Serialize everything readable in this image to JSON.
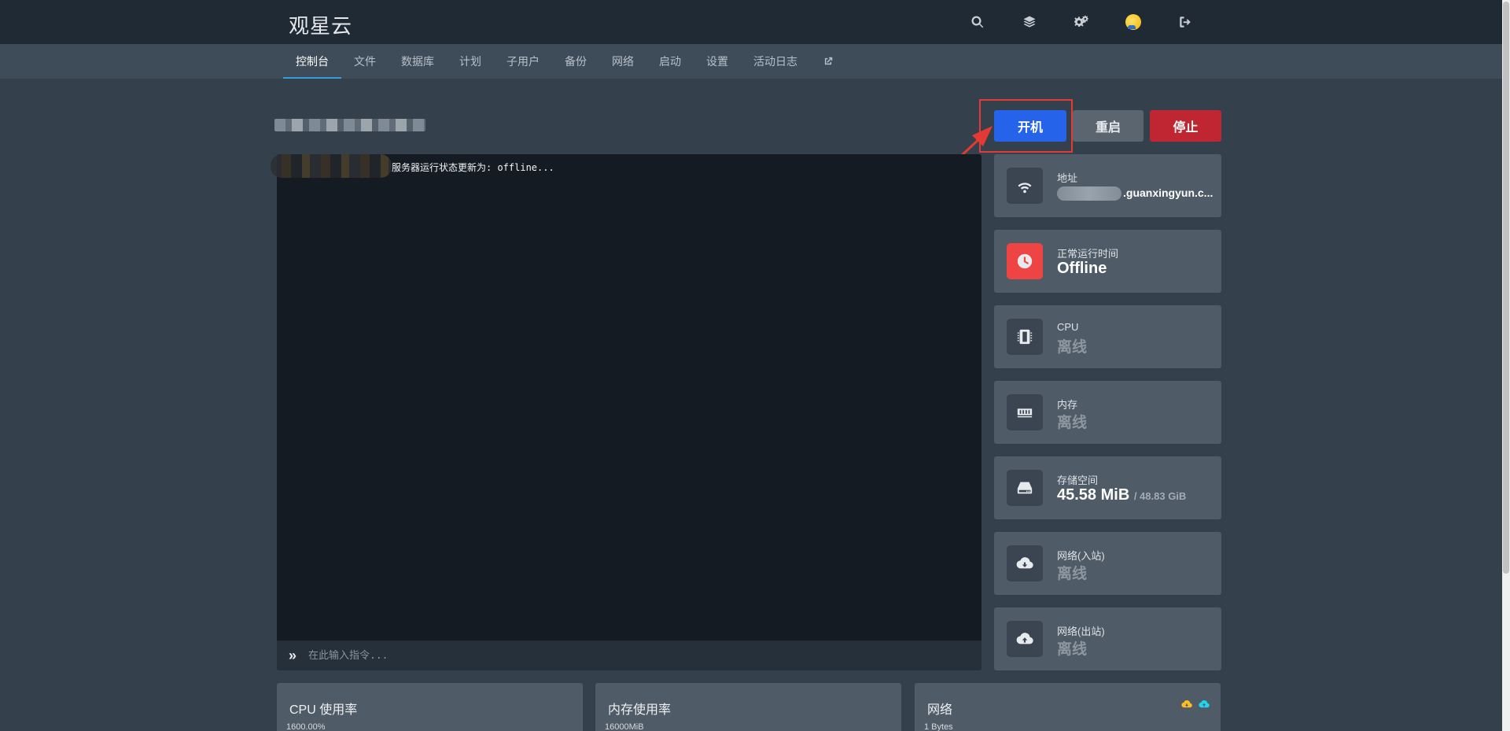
{
  "brand": "观星云",
  "header": {
    "icons": [
      "search-icon",
      "layers-icon",
      "cogs-icon",
      "avatar",
      "logout-icon"
    ]
  },
  "nav": {
    "tabs": [
      {
        "label": "控制台",
        "active": true
      },
      {
        "label": "文件"
      },
      {
        "label": "数据库"
      },
      {
        "label": "计划"
      },
      {
        "label": "子用户"
      },
      {
        "label": "备份"
      },
      {
        "label": "网络"
      },
      {
        "label": "启动"
      },
      {
        "label": "设置"
      },
      {
        "label": "活动日志"
      }
    ]
  },
  "power": {
    "start": "开机",
    "restart": "重启",
    "stop": "停止"
  },
  "console": {
    "line": "服务器运行状态更新为: offline...",
    "placeholder": "在此输入指令..."
  },
  "stats": {
    "address": {
      "label": "地址",
      "value": ".guanxingyun.c..."
    },
    "uptime": {
      "label": "正常运行时间",
      "value": "Offline"
    },
    "cpu": {
      "label": "CPU",
      "value": "离线"
    },
    "memory": {
      "label": "内存",
      "value": "离线"
    },
    "disk": {
      "label": "存储空间",
      "value": "45.58 MiB",
      "limit": "/ 48.83 GiB"
    },
    "net_in": {
      "label": "网络(入站)",
      "value": "离线"
    },
    "net_out": {
      "label": "网络(出站)",
      "value": "离线"
    }
  },
  "graphs": {
    "cpu": {
      "title": "CPU 使用率",
      "max": "1600.00%"
    },
    "memory": {
      "title": "内存使用率",
      "max": "16000MiB"
    },
    "network": {
      "title": "网络",
      "max": "1 Bytes"
    }
  },
  "colors": {
    "start": "#2563eb",
    "stop": "#bf2631",
    "highlight": "#e53935"
  }
}
